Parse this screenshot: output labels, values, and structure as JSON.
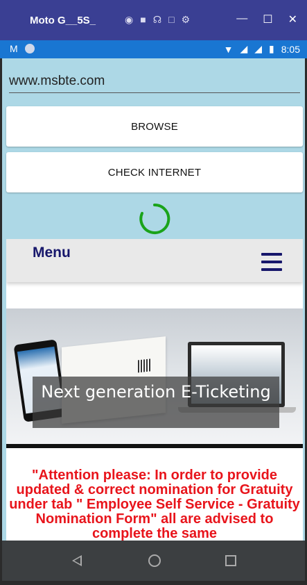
{
  "emulator": {
    "title": "Moto G__5S_",
    "icons": [
      "camera-icon",
      "video-icon",
      "headphones-icon",
      "fullscreen-icon",
      "gear-icon"
    ],
    "window_controls": [
      "minimize-icon",
      "maximize-icon",
      "close-icon"
    ]
  },
  "status_bar": {
    "left_icons": [
      "gmail-icon",
      "circle-icon"
    ],
    "right_icons": [
      "wifi-icon",
      "signal-icon",
      "signal-icon",
      "battery-icon"
    ],
    "time": "8:05",
    "color": "#1976d2"
  },
  "app": {
    "background": "#add8e6",
    "url_value": "www.msbte.com",
    "browse_label": "BROWSE",
    "check_label": "CHECK INTERNET",
    "spinner_color": "#1aa31a"
  },
  "web": {
    "menu_label": "Menu",
    "banner_caption": "Next generation E-Ticketing",
    "notice": "\"Attention please: In order to provide updated & correct nomination for Gratuity under tab \" Employee Self Service - Gratuity Nomination Form\" all are advised to complete the same",
    "notice_color": "#e8141b",
    "brand_color": "#17176b"
  },
  "navbar": {
    "icons": [
      "back-icon",
      "home-icon",
      "recents-icon"
    ]
  }
}
